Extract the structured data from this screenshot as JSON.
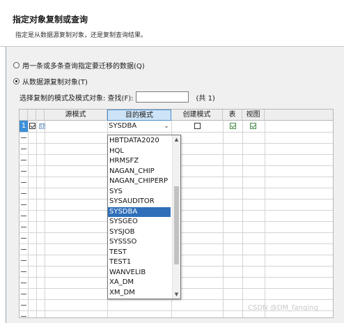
{
  "header": {
    "title": "指定对象复制或查询",
    "subtitle": "指定是从数据源复制对象，还是复制查询结果。"
  },
  "options": {
    "query_label": "用一条或多条查询指定要迁移的数据(Q)",
    "query_checked": false,
    "copy_label": "从数据源复制对象(T)",
    "copy_checked": true
  },
  "filter": {
    "label": "选择复制的模式及模式对象: 查找(F):",
    "value": "",
    "count": "(共 1)"
  },
  "grid": {
    "columns": [
      "源模式",
      "目的模式",
      "创建模式",
      "表",
      "视图"
    ],
    "active_column": "目的模式",
    "rows": [
      {
        "index": "1",
        "selected": true,
        "source_icon": "schema-icon",
        "source_icon_text": "{}",
        "target": "SYSDBA",
        "create": false,
        "table": true,
        "view": true
      }
    ]
  },
  "dropdown": {
    "items": [
      "HBTDATA2020",
      "HQL",
      "HRMSFZ",
      "NAGAN_CHIP",
      "NAGAN_CHIPERP",
      "SYS",
      "SYSAUDITOR",
      "SYSDBA",
      "SYSGEO",
      "SYSJOB",
      "SYSSSO",
      "TEST",
      "TEST1",
      "WANVELIB",
      "XA_DM",
      "XM_DM"
    ],
    "selected": "SYSDBA",
    "scroll_fraction": 0.62
  },
  "watermark": "CSDN @DM_fanqing",
  "colors": {
    "selection": "#2f6fb9",
    "row_header_selected": "#3d8fd8",
    "active_header": "#cde4f7",
    "panel_background": "#f0f0f0"
  }
}
